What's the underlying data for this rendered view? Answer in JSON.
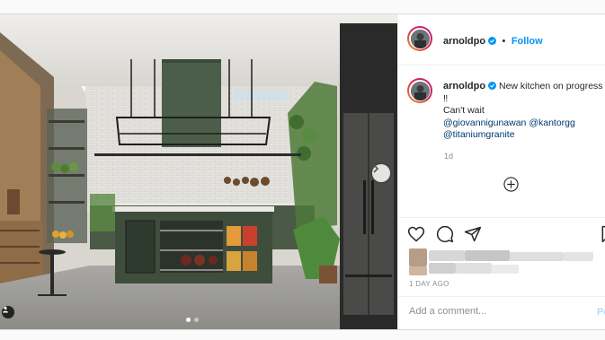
{
  "post": {
    "image_alt": "kitchen rendering",
    "dots": 2,
    "active_dot": 0
  },
  "header": {
    "username": "arnoldpo",
    "separator": "•",
    "follow_label": "Follow"
  },
  "caption": {
    "username": "arnoldpo",
    "text_line1": "New kitchen on progress",
    "text_line2": "‼",
    "text_line3": "Can't wait",
    "mention1": "@giovannigunawan",
    "mention2": "@kantorgg",
    "mention3": "@titaniumgranite",
    "age": "1d"
  },
  "actions": {
    "date": "1 DAY AGO"
  },
  "comment": {
    "placeholder": "Add a comment...",
    "post_label": "Po"
  },
  "colors": {
    "accent": "#0095f6",
    "mention": "#00376b",
    "muted": "#8e8e8e",
    "text": "#262626"
  }
}
